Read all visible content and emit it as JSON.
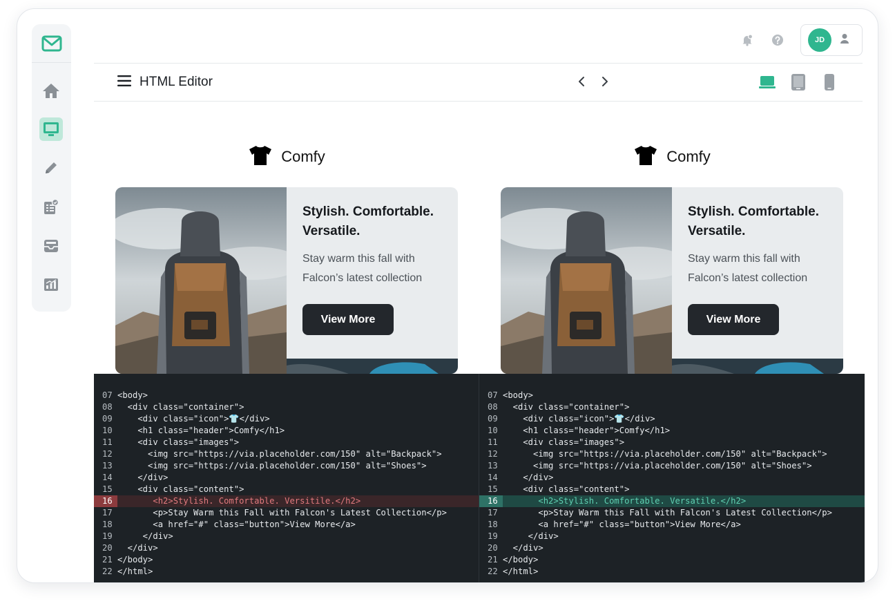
{
  "editor": {
    "title": "HTML Editor"
  },
  "profile": {
    "initials": "JD"
  },
  "colors": {
    "accent": "#2fb68f",
    "dark": "#23272c",
    "removed": "#e27a7e",
    "added": "#5fd1b2"
  },
  "sidebar": {
    "items": [
      {
        "name": "home-icon",
        "active": false
      },
      {
        "name": "monitor-icon",
        "active": true
      },
      {
        "name": "pencil-icon",
        "active": false
      },
      {
        "name": "checklist-icon",
        "active": false
      },
      {
        "name": "inbox-icon",
        "active": false
      },
      {
        "name": "chart-icon",
        "active": false
      }
    ]
  },
  "topbar": {
    "icons": [
      "bell-icon",
      "help-icon",
      "user-icon"
    ]
  },
  "devices": [
    "laptop-icon",
    "tablet-icon",
    "phone-icon"
  ],
  "previews": [
    {
      "brand": "Comfy",
      "headline": "Stylish. Comfortable. Versatile.",
      "text": "Stay warm this fall with Falcon’s latest collection",
      "button": "View More"
    },
    {
      "brand": "Comfy",
      "headline": "Stylish. Comfortable. Versatile.",
      "text": "Stay warm this fall with Falcon’s latest collection",
      "button": "View More"
    }
  ],
  "code": {
    "left": [
      {
        "n": "07",
        "t": "<body>"
      },
      {
        "n": "08",
        "t": "  <div class=\"container\">"
      },
      {
        "n": "09",
        "t": "    <div class=\"icon\">👕</div>"
      },
      {
        "n": "10",
        "t": "    <h1 class=\"header\">Comfy</h1>"
      },
      {
        "n": "11",
        "t": "    <div class=\"images\">"
      },
      {
        "n": "12",
        "t": "      <img src=\"https://via.placeholder.com/150\" alt=\"Backpack\">"
      },
      {
        "n": "13",
        "t": "      <img src=\"https://via.placeholder.com/150\" alt=\"Shoes\">"
      },
      {
        "n": "14",
        "t": "    </div>"
      },
      {
        "n": "15",
        "t": "    <div class=\"content\">"
      },
      {
        "n": "16",
        "t": "       <h2>Stylish. Comfortable. Versitile.</h2>",
        "state": "del"
      },
      {
        "n": "17",
        "t": "       <p>Stay Warm this Fall with Falcon's Latest Collection</p>"
      },
      {
        "n": "18",
        "t": "       <a href=\"#\" class=\"button\">View More</a>"
      },
      {
        "n": "19",
        "t": "     </div>"
      },
      {
        "n": "20",
        "t": "  </div>"
      },
      {
        "n": "21",
        "t": "</body>"
      },
      {
        "n": "22",
        "t": "</html>"
      }
    ],
    "right": [
      {
        "n": "07",
        "t": "<body>"
      },
      {
        "n": "08",
        "t": "  <div class=\"container\">"
      },
      {
        "n": "09",
        "t": "    <div class=\"icon\">👕</div>"
      },
      {
        "n": "10",
        "t": "    <h1 class=\"header\">Comfy</h1>"
      },
      {
        "n": "11",
        "t": "    <div class=\"images\">"
      },
      {
        "n": "12",
        "t": "      <img src=\"https://via.placeholder.com/150\" alt=\"Backpack\">"
      },
      {
        "n": "13",
        "t": "      <img src=\"https://via.placeholder.com/150\" alt=\"Shoes\">"
      },
      {
        "n": "14",
        "t": "    </div>"
      },
      {
        "n": "15",
        "t": "    <div class=\"content\">"
      },
      {
        "n": "16",
        "t": "       <h2>Stylish. Comfortable. Versatile.</h2>",
        "state": "add"
      },
      {
        "n": "17",
        "t": "       <p>Stay Warm this Fall with Falcon's Latest Collection</p>"
      },
      {
        "n": "18",
        "t": "       <a href=\"#\" class=\"button\">View More</a>"
      },
      {
        "n": "19",
        "t": "     </div>"
      },
      {
        "n": "20",
        "t": "  </div>"
      },
      {
        "n": "21",
        "t": "</body>"
      },
      {
        "n": "22",
        "t": "</html>"
      }
    ]
  }
}
